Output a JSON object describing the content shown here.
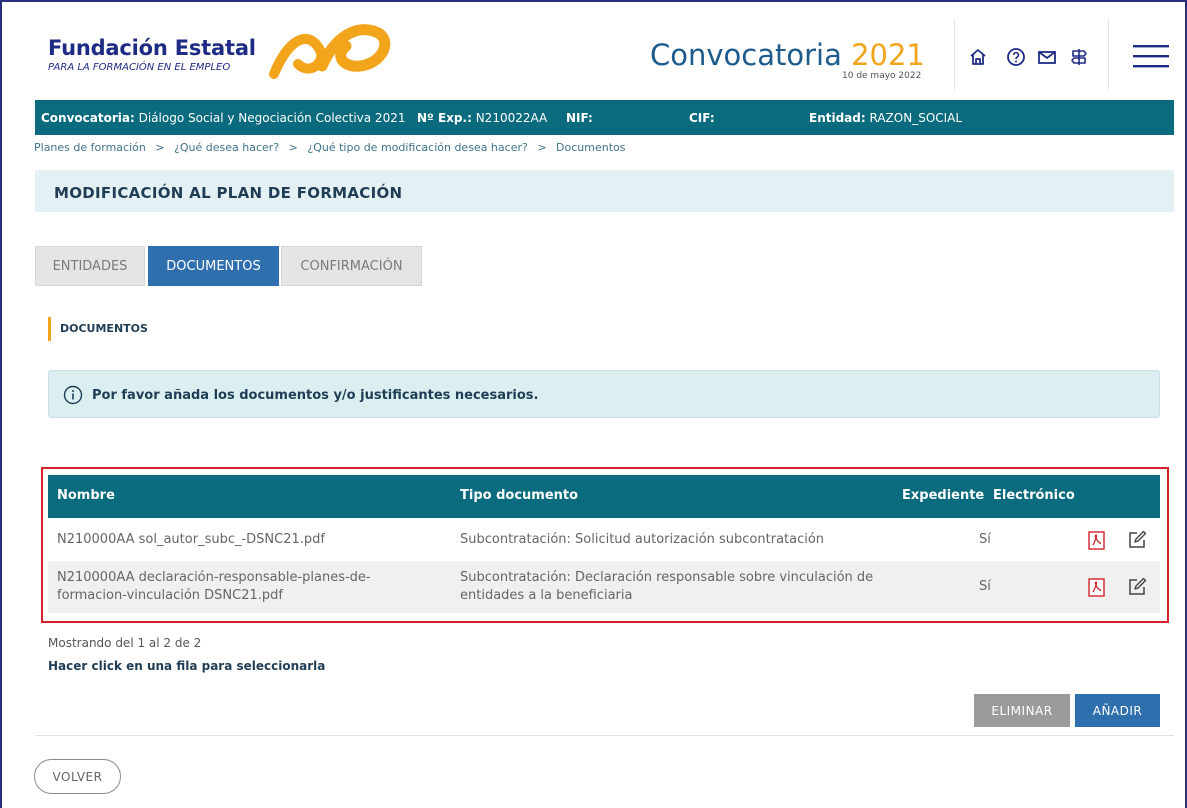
{
  "header": {
    "brand_name": "Fundación Estatal",
    "brand_tagline": "PARA LA FORMACIÓN EN EL EMPLEO",
    "title_prefix": "Convocatoria ",
    "title_year": "2021",
    "date": "10 de mayo 2022",
    "icons": [
      "home-icon",
      "help-icon",
      "mail-icon",
      "signpost-icon",
      "menu-icon"
    ],
    "colors": {
      "brand_blue": "#1e2b84",
      "accent_orange": "#f2a41b",
      "teal": "#0a6b7f"
    }
  },
  "infobar": {
    "convocatoria_label": "Convocatoria:",
    "convocatoria_value": "Diálogo Social y Negociación Colectiva 2021",
    "exp_label": "Nº Exp.:",
    "exp_value": "N210022AA",
    "nif_label": "NIF:",
    "cif_label": "CIF:",
    "entidad_label": "Entidad:",
    "entidad_value": "RAZON_SOCIAL"
  },
  "breadcrumb": {
    "items": [
      "Planes de formación",
      "¿Qué desea hacer?",
      "¿Qué tipo de modificación desea hacer?",
      "Documentos"
    ],
    "separator": ">"
  },
  "page": {
    "title": "MODIFICACIÓN AL PLAN DE FORMACIÓN",
    "tabs": [
      {
        "label": "ENTIDADES",
        "active": false
      },
      {
        "label": "DOCUMENTOS",
        "active": true
      },
      {
        "label": "CONFIRMACIÓN",
        "active": false
      }
    ],
    "section_label": "DOCUMENTOS",
    "alert_text": "Por favor añada los documentos y/o justificantes necesarios."
  },
  "table": {
    "columns": [
      "Nombre",
      "Tipo documento",
      "Expediente",
      "Electrónico"
    ],
    "rows": [
      {
        "nombre": [
          "N210000AA sol_autor_subc_-DSNC21.pdf"
        ],
        "tipo": [
          "Subcontratación: Solicitud autorización subcontratación"
        ],
        "expediente": "",
        "electronico": "Sí"
      },
      {
        "nombre": [
          "N210000AA declaración-responsable-planes-de-",
          "formacion-vinculación DSNC21.pdf"
        ],
        "tipo": [
          "Subcontratación: Declaración responsable sobre vinculación de",
          "entidades a la beneficiaria"
        ],
        "expediente": "",
        "electronico": "Sí"
      }
    ],
    "showing": "Mostrando del 1 al 2 de 2",
    "hint": "Hacer click en una fila para seleccionarla"
  },
  "actions": {
    "delete_label": "ELIMINAR",
    "add_label": "AÑADIR",
    "back_label": "VOLVER"
  }
}
